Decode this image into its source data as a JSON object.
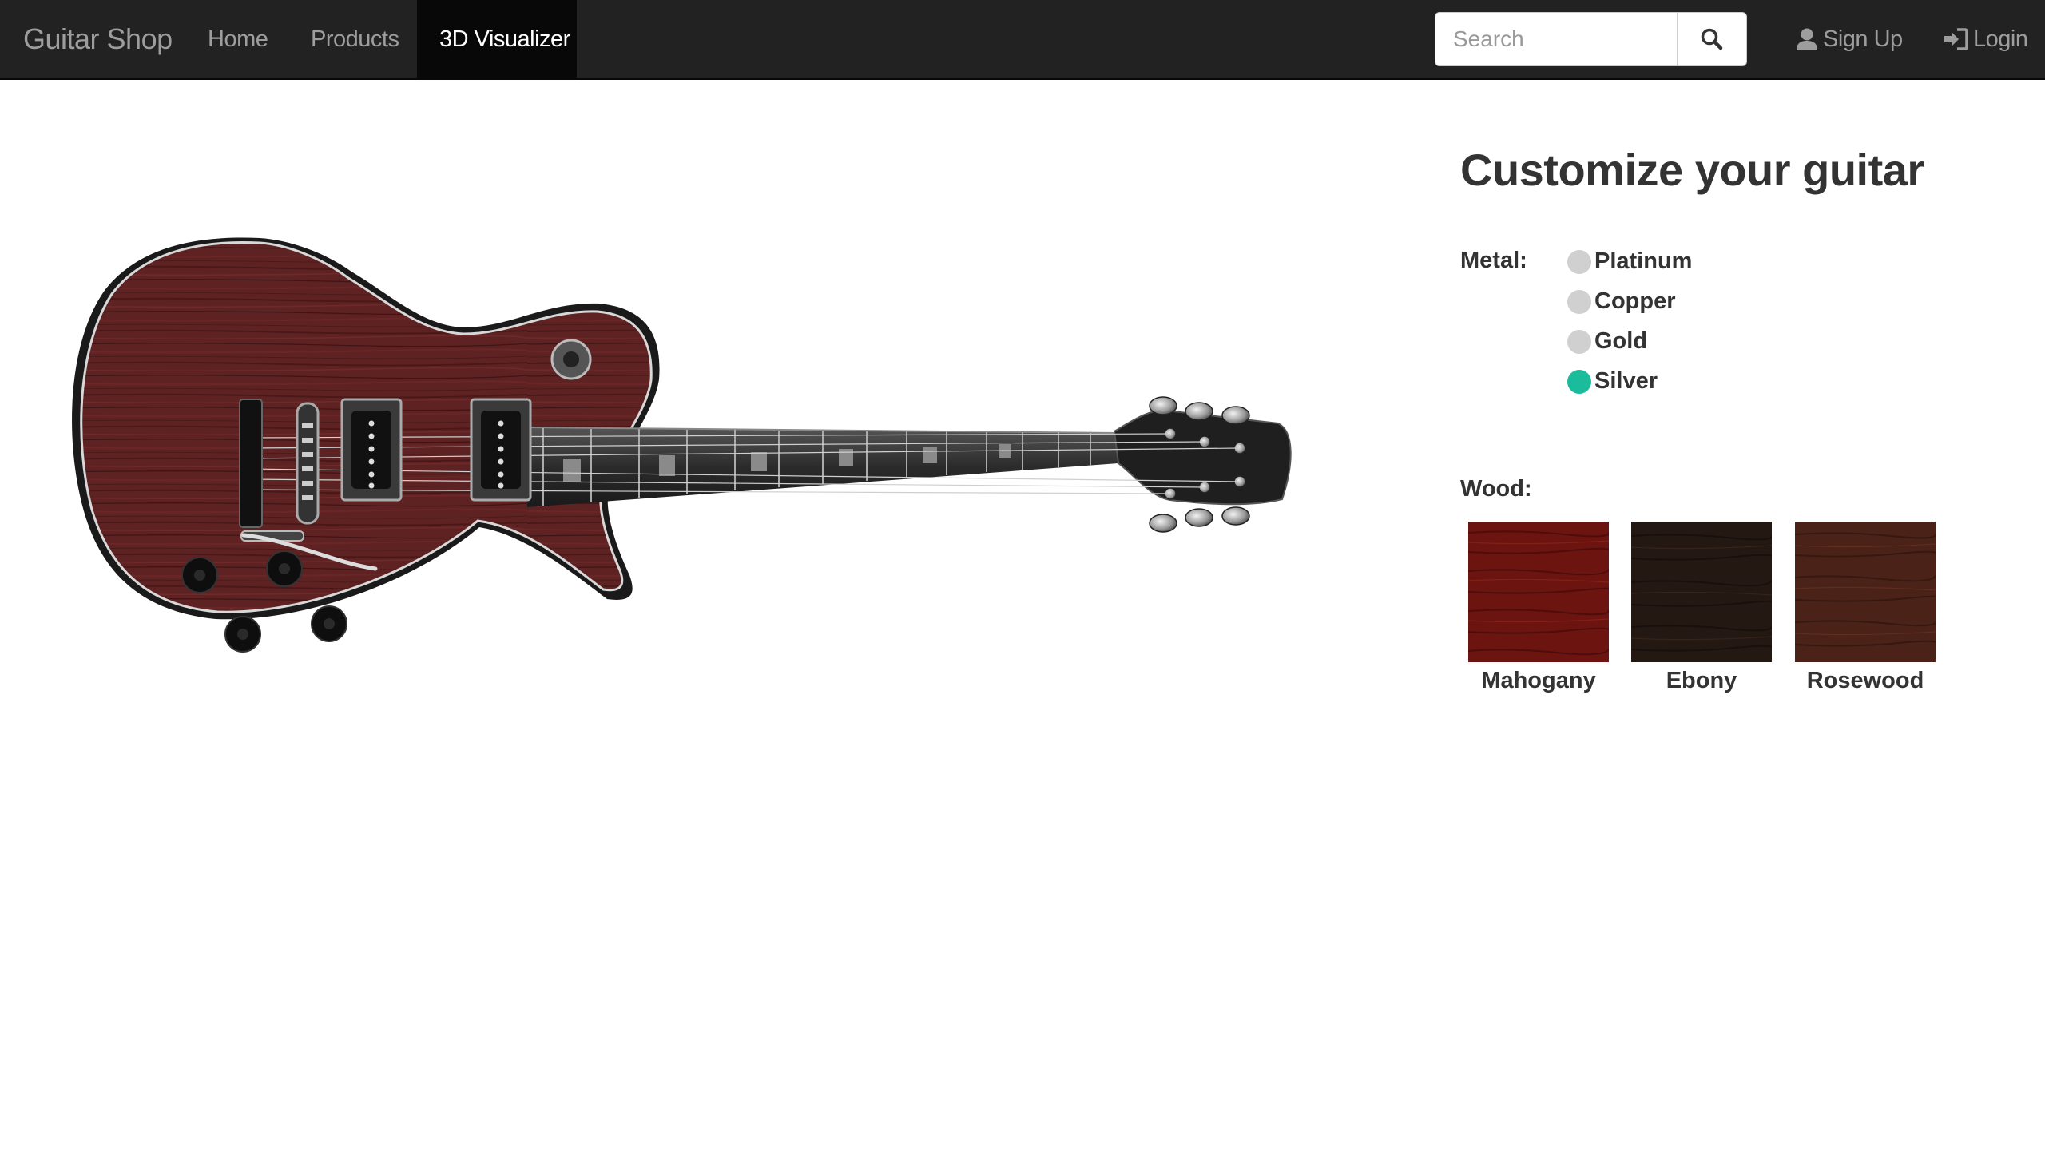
{
  "nav": {
    "brand": "Guitar Shop",
    "home": "Home",
    "products": "Products",
    "visualizer": "3D Visualizer",
    "search_placeholder": "Search",
    "search_icon": "magnifier",
    "signup": "Sign Up",
    "login": "Login",
    "signup_icon": "user",
    "login_icon": "sign-in"
  },
  "panel": {
    "title": "Customize your guitar",
    "metal_label": "Metal:",
    "metals": [
      {
        "label": "Platinum",
        "selected": false
      },
      {
        "label": "Copper",
        "selected": false
      },
      {
        "label": "Gold",
        "selected": false
      },
      {
        "label": "Silver",
        "selected": true
      }
    ],
    "wood_label": "Wood:",
    "woods": [
      {
        "label": "Mahogany",
        "color": "#6b1410"
      },
      {
        "label": "Ebony",
        "color": "#241812"
      },
      {
        "label": "Rosewood",
        "color": "#4a2218"
      }
    ]
  },
  "colors": {
    "navbar": "#222222",
    "accent": "#1abc9c",
    "body_wood": "#5e2222"
  }
}
